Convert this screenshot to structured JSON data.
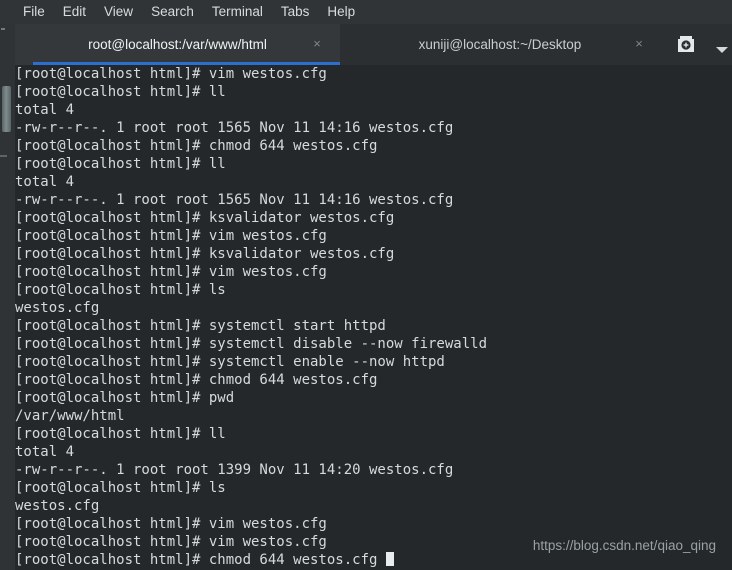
{
  "window": {
    "background_color": "#24282b",
    "menubar_color": "#303436",
    "accent_color": "#2d6fd1",
    "text_color": "#d6dadb"
  },
  "menubar": {
    "items": [
      {
        "label": "File"
      },
      {
        "label": "Edit"
      },
      {
        "label": "View"
      },
      {
        "label": "Search"
      },
      {
        "label": "Terminal"
      },
      {
        "label": "Tabs"
      },
      {
        "label": "Help"
      }
    ]
  },
  "tabbar": {
    "tabs": [
      {
        "title": "root@localhost:/var/www/html",
        "active": true,
        "close_label": "×"
      },
      {
        "title": "xuniji@localhost:~/Desktop",
        "active": false,
        "close_label": "×"
      }
    ],
    "new_tab_icon": "new-tab-icon",
    "dropdown_icon": "chevron-down-icon"
  },
  "terminal": {
    "prompt": "[root@localhost html]#",
    "cursor": "block",
    "lines": [
      "[root@localhost html]# vim westos.cfg",
      "[root@localhost html]# ll",
      "total 4",
      "-rw-r--r--. 1 root root 1565 Nov 11 14:16 westos.cfg",
      "[root@localhost html]# chmod 644 westos.cfg",
      "[root@localhost html]# ll",
      "total 4",
      "-rw-r--r--. 1 root root 1565 Nov 11 14:16 westos.cfg",
      "[root@localhost html]# ksvalidator westos.cfg",
      "[root@localhost html]# vim westos.cfg",
      "[root@localhost html]# ksvalidator westos.cfg",
      "[root@localhost html]# vim westos.cfg",
      "[root@localhost html]# ls",
      "westos.cfg",
      "[root@localhost html]# systemctl start httpd",
      "[root@localhost html]# systemctl disable --now firewalld",
      "[root@localhost html]# systemctl enable --now httpd",
      "[root@localhost html]# chmod 644 westos.cfg",
      "[root@localhost html]# pwd",
      "/var/www/html",
      "[root@localhost html]# ll",
      "total 4",
      "-rw-r--r--. 1 root root 1399 Nov 11 14:20 westos.cfg",
      "[root@localhost html]# ls",
      "westos.cfg",
      "[root@localhost html]# vim westos.cfg",
      "[root@localhost html]# vim westos.cfg"
    ],
    "last_line": "[root@localhost html]# chmod 644 westos.cfg "
  },
  "watermark": {
    "text": "https://blog.csdn.net/qiao_qing"
  }
}
